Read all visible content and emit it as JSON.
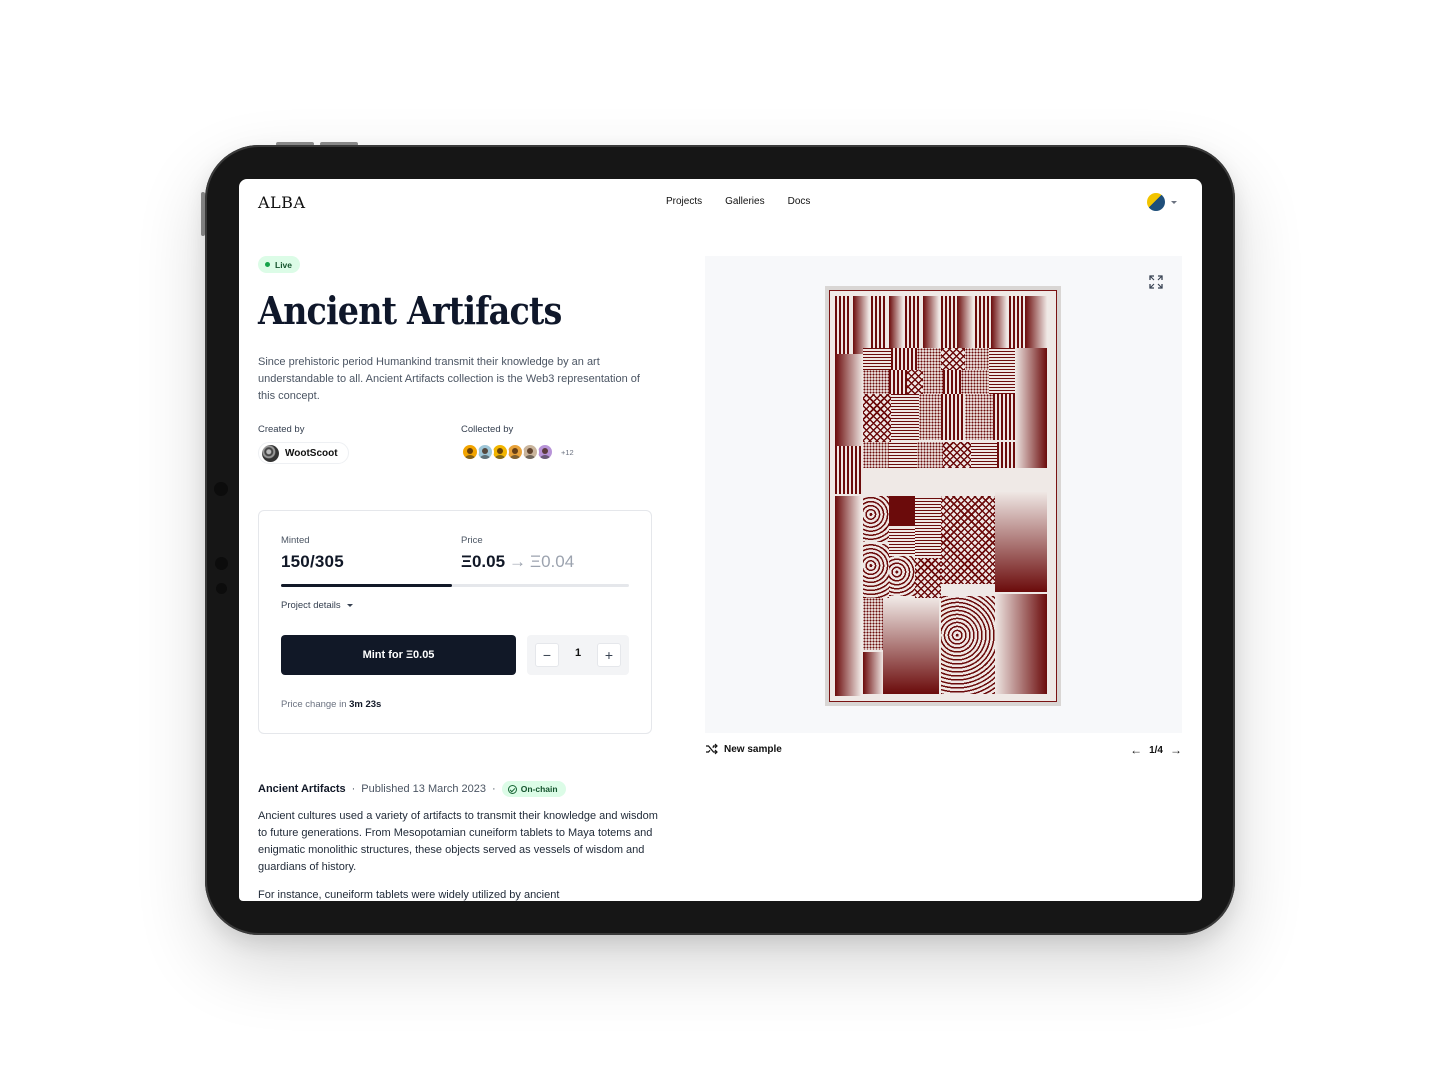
{
  "header": {
    "logo": "ALBA",
    "nav": [
      "Projects",
      "Galleries",
      "Docs"
    ]
  },
  "project": {
    "status": "Live",
    "title": "Ancient Artifacts",
    "description": "Since prehistoric period Humankind transmit their knowledge by an art understandable to all. Ancient Artifacts collection is the Web3 representation of this concept.",
    "created_by_label": "Created by",
    "creator": "WootScoot",
    "collected_by_label": "Collected by",
    "collectors_more": "+12",
    "collector_colors": [
      "#f2a400",
      "#9fc7d9",
      "#f2b500",
      "#e8a23a",
      "#c9b49c",
      "#b894d8"
    ]
  },
  "mint_card": {
    "minted_label": "Minted",
    "minted_value": "150/305",
    "minted_progress": 0.49,
    "price_label": "Price",
    "price_now": "Ξ0.05",
    "price_next": "Ξ0.04",
    "details_toggle": "Project details",
    "mint_button": "Mint for Ξ0.05",
    "quantity": "1",
    "price_change_prefix": "Price change in",
    "price_change_time": "3m 23s"
  },
  "article": {
    "project": "Ancient Artifacts",
    "published": "Published 13 March 2023",
    "badge": "On-chain",
    "paragraph1": "Ancient cultures used a variety of artifacts to transmit their knowledge and wisdom to future generations. From Mesopotamian cuneiform tablets to Maya totems and enigmatic monolithic structures, these objects served as vessels of wisdom and guardians of history.",
    "paragraph2": "For instance, cuneiform tablets were widely utilized by ancient"
  },
  "preview": {
    "new_sample": "New sample",
    "pager": "1/4"
  },
  "colors": {
    "accent_dark": "#111827",
    "live_bg": "#dcfce7",
    "art_red": "#6b0b0b"
  }
}
